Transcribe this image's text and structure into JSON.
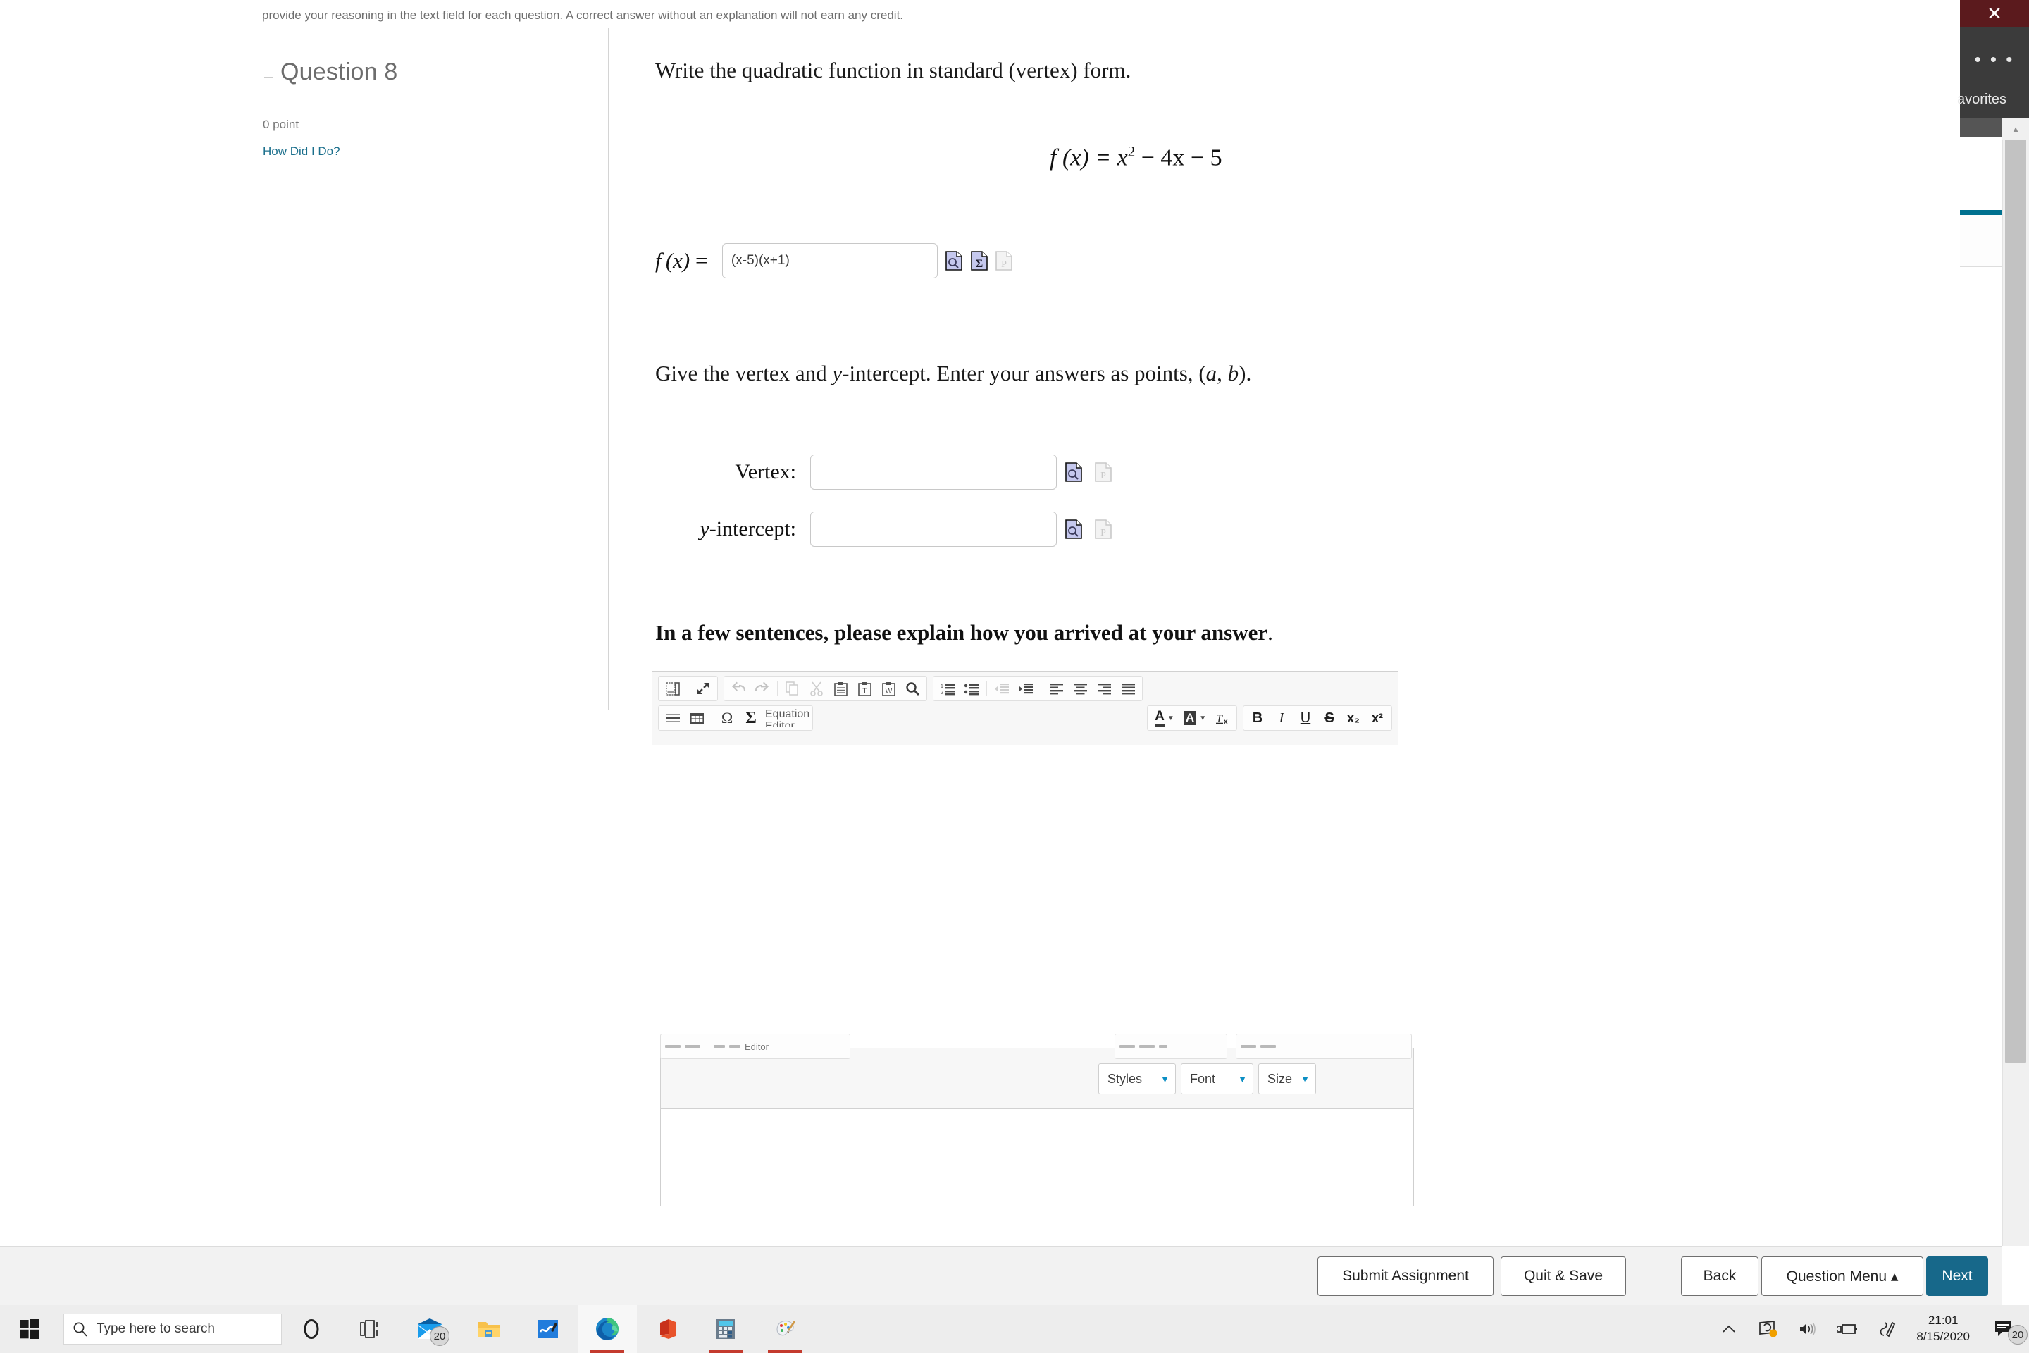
{
  "instructions": {
    "text": "provide your reasoning in the text field for each question. A correct answer without an explanation will not earn any credit."
  },
  "question_rail": {
    "collapse_icon": "minus-icon",
    "title": "Question 8",
    "points": "0 point",
    "how_did_i_do": "How Did I Do?"
  },
  "content": {
    "prompt_1": "Write the quadratic function in standard (vertex) form.",
    "equation": {
      "lhs": "f (x) =",
      "rhs_base": "x",
      "rhs_exp": "2",
      "rhs_rest": "− 4x − 5",
      "plain": "f(x) = x^2 - 4x - 5"
    },
    "answer_row": {
      "label": "f (x) =",
      "value": "(x-5)(x+1)",
      "placeholder": "",
      "icons": [
        "preview-icon",
        "sigma-equation-icon",
        "palette-icon-disabled"
      ]
    },
    "prompt_2": "Give the vertex and y-intercept. Enter your answers as points, (a, b).",
    "prompt_2_parts": {
      "a": "Give the vertex and ",
      "y": "y",
      "b": "-intercept. Enter your answers as points, ",
      "point_open": "(",
      "point_a": "a",
      "point_comma": ", ",
      "point_b": "b",
      "point_close": ")",
      "period": "."
    },
    "fields": [
      {
        "label": "Vertex:",
        "label_italic": "",
        "value": "",
        "placeholder": ""
      },
      {
        "label": "-intercept:",
        "label_italic": "y",
        "value": "",
        "placeholder": ""
      }
    ],
    "prompt_3": "In a few sentences, please explain how you arrived at your answer",
    "prompt_3_period": "."
  },
  "editor": {
    "toolbar_row1": [
      {
        "name": "templates-icon",
        "glyph": "▤",
        "disabled": false
      },
      {
        "name": "maximize-icon",
        "glyph": "⤢",
        "disabled": false
      },
      {
        "name": "undo-icon",
        "glyph": "↶",
        "disabled": true
      },
      {
        "name": "redo-icon",
        "glyph": "↷",
        "disabled": true
      },
      {
        "name": "copy-icon",
        "glyph": "❐",
        "disabled": true
      },
      {
        "name": "cut-icon",
        "glyph": "✂",
        "disabled": true
      },
      {
        "name": "paste-icon",
        "glyph": "Ὄb",
        "disabled": false
      },
      {
        "name": "paste-as-text-icon",
        "glyph": "T",
        "disabled": false
      },
      {
        "name": "paste-from-word-icon",
        "glyph": "W",
        "disabled": false
      },
      {
        "name": "find-icon",
        "glyph": "⌕",
        "disabled": false
      },
      {
        "name": "numbered-list-icon",
        "glyph": "1≡",
        "disabled": false
      },
      {
        "name": "bulleted-list-icon",
        "glyph": "•≡",
        "disabled": false
      },
      {
        "name": "decrease-indent-icon",
        "glyph": "←≡",
        "disabled": true
      },
      {
        "name": "increase-indent-icon",
        "glyph": "→≡",
        "disabled": false
      },
      {
        "name": "align-left-icon",
        "glyph": "≡",
        "disabled": false
      },
      {
        "name": "align-center-icon",
        "glyph": "≡",
        "disabled": false
      },
      {
        "name": "align-right-icon",
        "glyph": "≡",
        "disabled": false
      },
      {
        "name": "justify-icon",
        "glyph": "≡",
        "disabled": false
      }
    ],
    "toolbar_row2": {
      "horizontal_rule": "horizontal-rule-icon",
      "table": "table-icon",
      "omega": "Ω",
      "sigma": "Σ",
      "equation_editor_label": "Equation\nEditor",
      "text_color": "A",
      "bg_color": "A",
      "remove_format": "remove-format-icon",
      "bold": "B",
      "italic": "I",
      "underline": "U",
      "strike": "S",
      "subscript": "x₂",
      "superscript": "x²"
    },
    "dropdowns": [
      {
        "name": "styles-dropdown",
        "label": "Styles"
      },
      {
        "name": "font-dropdown",
        "label": "Font"
      },
      {
        "name": "size-dropdown",
        "label": "Size"
      }
    ]
  },
  "action_bar": {
    "buttons": [
      {
        "name": "submit-assignment-button",
        "label": "Submit Assignment",
        "primary": false
      },
      {
        "name": "quit-and-save-button",
        "label": "Quit & Save",
        "primary": false
      },
      {
        "name": "back-button",
        "label": "Back",
        "primary": false
      },
      {
        "name": "question-menu-button",
        "label": "Question Menu ▴",
        "primary": false
      },
      {
        "name": "next-button",
        "label": "Next",
        "primary": true
      }
    ]
  },
  "overlay": {
    "close": "✕",
    "more": "• • •",
    "favorites": "avorites"
  },
  "taskbar": {
    "start": "windows-logo-icon",
    "search_placeholder": "Type here to search",
    "icons": [
      {
        "name": "cortana-icon",
        "badge": "",
        "active": false,
        "underline": false
      },
      {
        "name": "task-view-icon",
        "badge": "",
        "active": false,
        "underline": false
      },
      {
        "name": "mail-icon",
        "badge": "20",
        "active": false,
        "underline": false
      },
      {
        "name": "file-explorer-icon",
        "badge": "",
        "active": false,
        "underline": false
      },
      {
        "name": "sticky-notes-icon",
        "badge": "",
        "active": false,
        "underline": false
      },
      {
        "name": "edge-icon",
        "badge": "",
        "active": true,
        "underline": true
      },
      {
        "name": "office-icon",
        "badge": "",
        "active": false,
        "underline": false
      },
      {
        "name": "calculator-icon",
        "badge": "",
        "active": false,
        "underline": true
      },
      {
        "name": "paint-icon",
        "badge": "",
        "active": false,
        "underline": true
      }
    ],
    "tray": {
      "chevron": "˄",
      "onedrive": "sync-icon",
      "volume": "volume-icon",
      "battery": "battery-charging-icon",
      "pen": "windows-ink-icon",
      "time": "21:01",
      "date": "8/15/2020",
      "notification_badge": "20"
    }
  },
  "colors": {
    "accent_teal": "#17688a",
    "link_blue": "#1b6f8c",
    "taskbar_bg": "#ededed",
    "action_bar_bg": "#f2f2f2",
    "icon_fill": "#c5c8ee"
  }
}
